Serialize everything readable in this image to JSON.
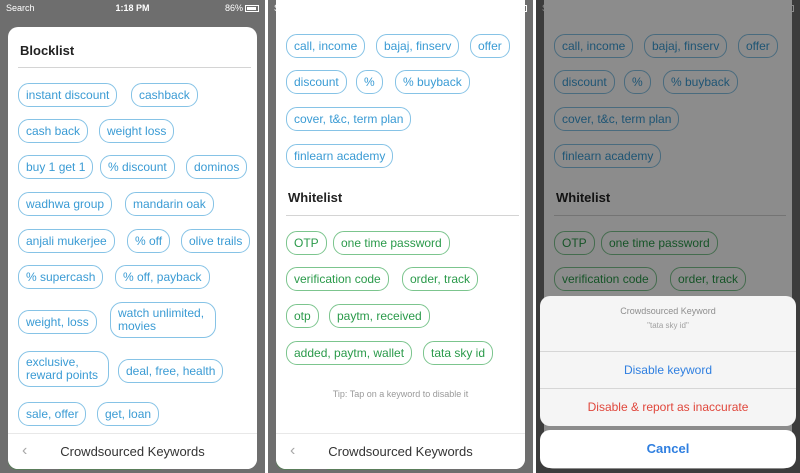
{
  "status": {
    "carrier": "Search",
    "time": "1:18 PM",
    "battery": "86%"
  },
  "sheet_title": "Crowdsourced Keywords",
  "blocklist": {
    "title": "Blocklist",
    "keywords": [
      "instant discount",
      "cashback",
      "cash back",
      "weight loss",
      "buy 1 get 1",
      "% discount",
      "dominos",
      "wadhwa group",
      "mandarin oak",
      "anjali mukerjee",
      "% off",
      "olive trails",
      "% supercash",
      "% off, payback",
      "weight, loss",
      "watch unlimited, movies",
      "exclusive, reward points",
      "deal, free, health",
      "sale, offer",
      "get, loan"
    ]
  },
  "blocklist_more": [
    "call, income",
    "bajaj, finserv",
    "offer",
    "discount",
    "%",
    "% buyback",
    "cover, t&c, term plan",
    "finlearn academy"
  ],
  "whitelist": {
    "title": "Whitelist",
    "keywords": [
      "OTP",
      "one time password",
      "verification code",
      "order, track",
      "otp",
      "paytm, received",
      "added, paytm, wallet",
      "tata sky id"
    ]
  },
  "tip": "Tip: Tap on a keyword to disable it",
  "action_sheet": {
    "title": "Crowdsourced Keyword",
    "subtitle": "\"tata sky id\"",
    "disable": "Disable keyword",
    "report": "Disable & report as inaccurate",
    "cancel": "Cancel"
  },
  "colors": {
    "blue": "#3a9bd4",
    "green": "#2a9a4a",
    "action_blue": "#2f7fe0",
    "destructive_red": "#e0473c"
  }
}
